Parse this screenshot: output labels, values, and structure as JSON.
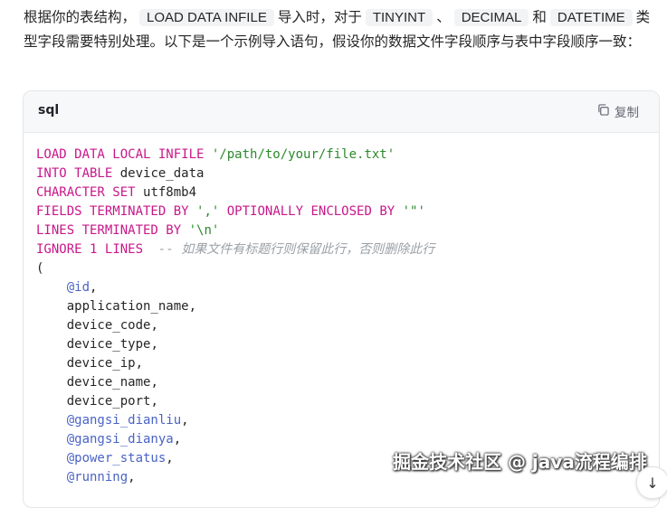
{
  "intro": {
    "t1": "根据你的表结构，",
    "c1": "LOAD DATA INFILE",
    "t2": "导入时，对于",
    "c2": "TINYINT",
    "t3": "、",
    "c3": "DECIMAL",
    "t4": "和",
    "c4": "DATETIME",
    "t5": "类型字段需要特别处理。以下是一个示例导入语句，假设你的数据文件字段顺序与表中字段顺序一致："
  },
  "codeblock": {
    "language": "sql",
    "copy_label": "复制",
    "copy_icon": "copy-icon",
    "lines": {
      "l1_kw": "LOAD DATA LOCAL INFILE",
      "l1_str": "'/path/to/your/file.txt'",
      "l2_kw": "INTO TABLE",
      "l2_id": "device_data",
      "l3_kw": "CHARACTER SET",
      "l3_id": "utf8mb4",
      "l4_kw1": "FIELDS TERMINATED BY",
      "l4_str1": "','",
      "l4_kw2": "OPTIONALLY ENCLOSED BY",
      "l4_str2": "'\"'",
      "l5_kw": "LINES TERMINATED BY",
      "l5_str": "'\\n'",
      "l6_kw1": "IGNORE",
      "l6_num": "1",
      "l6_kw2": "LINES",
      "l6_cm": "-- 如果文件有标题行则保留此行，否则删除此行",
      "l7": "(",
      "l8": "@id",
      "l9": "application_name",
      "l10": "device_code",
      "l11": "device_type",
      "l12": "device_ip",
      "l13": "device_name",
      "l14": "device_port",
      "l15": "@gangsi_dianliu",
      "l16": "@gangsi_dianya",
      "l17": "@power_status",
      "l18": "@running"
    }
  },
  "watermark": "掘金技术社区 @ java流程编排",
  "scroll_down_icon": "arrow-down-icon"
}
